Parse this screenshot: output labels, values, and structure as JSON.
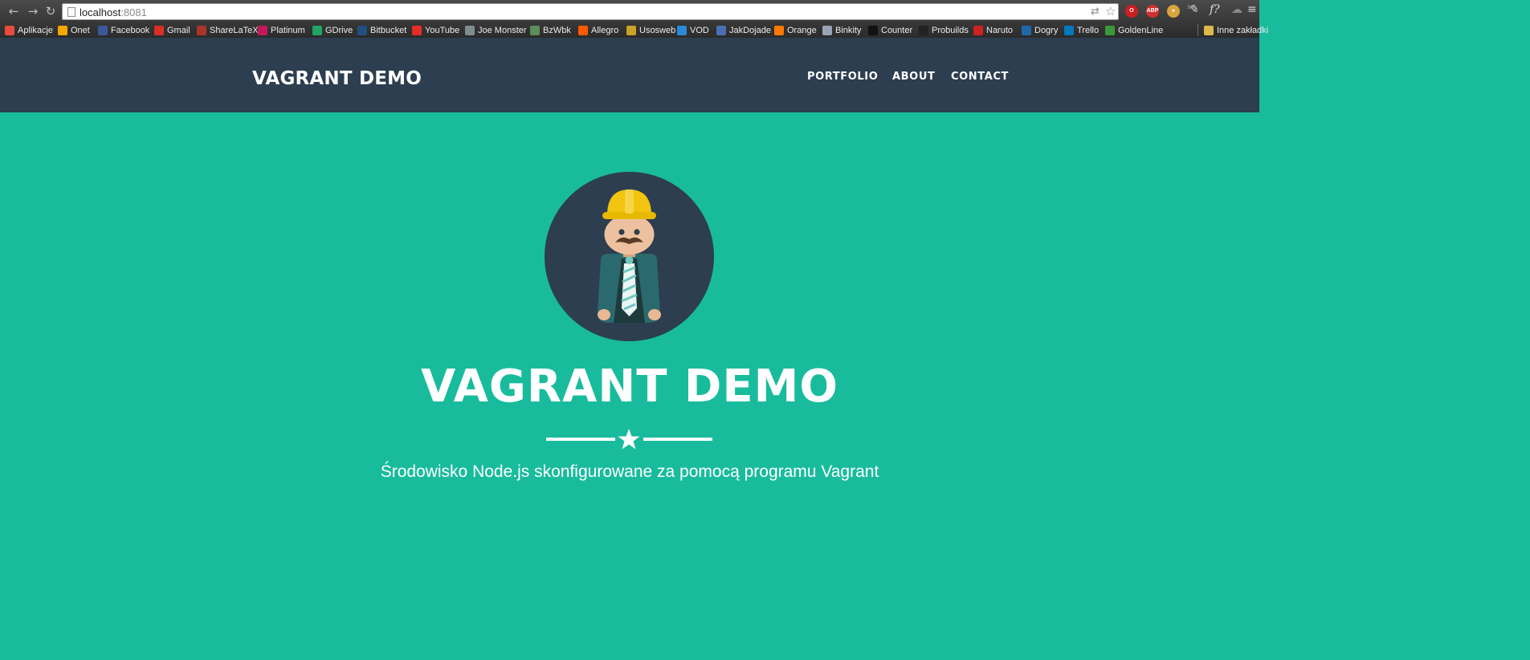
{
  "browser": {
    "url_host": "localhost",
    "url_port": ":8081",
    "bookmarks": [
      {
        "label": "Aplikacje",
        "icon": "apps-grid-icon",
        "color": "#e74c3c"
      },
      {
        "label": "Onet",
        "icon": "onet-icon",
        "color": "#f5a500"
      },
      {
        "label": "Facebook",
        "icon": "facebook-icon",
        "color": "#3b5998"
      },
      {
        "label": "Gmail",
        "icon": "gmail-icon",
        "color": "#d93025"
      },
      {
        "label": "ShareLaTeX",
        "icon": "sharelatex-icon",
        "color": "#a93529"
      },
      {
        "label": "Platinum",
        "icon": "platinum-icon",
        "color": "#c2185b"
      },
      {
        "label": "GDrive",
        "icon": "gdrive-icon",
        "color": "#1fa463"
      },
      {
        "label": "Bitbucket",
        "icon": "bitbucket-icon",
        "color": "#205081"
      },
      {
        "label": "YouTube",
        "icon": "youtube-icon",
        "color": "#e52d27"
      },
      {
        "label": "Joe Monster",
        "icon": "joemonster-icon",
        "color": "#7f8c8d"
      },
      {
        "label": "BzWbk",
        "icon": "bzwbk-icon",
        "color": "#5a8f5a"
      },
      {
        "label": "Allegro",
        "icon": "allegro-icon",
        "color": "#ff5a00"
      },
      {
        "label": "Usosweb",
        "icon": "usosweb-icon",
        "color": "#c9a227"
      },
      {
        "label": "VOD",
        "icon": "vod-icon",
        "color": "#2a8ad8"
      },
      {
        "label": "JakDojade",
        "icon": "jakdojade-icon",
        "color": "#4a6fb5"
      },
      {
        "label": "Orange",
        "icon": "orange-icon",
        "color": "#ff7900"
      },
      {
        "label": "Binkity",
        "icon": "binkity-icon",
        "color": "#9aa3b5"
      },
      {
        "label": "Counter",
        "icon": "counter-icon",
        "color": "#111111"
      },
      {
        "label": "Probuilds",
        "icon": "probuilds-icon",
        "color": "#222222"
      },
      {
        "label": "Naruto",
        "icon": "naruto-icon",
        "color": "#cc2222"
      },
      {
        "label": "Dogry",
        "icon": "dogry-icon",
        "color": "#1e6aa8"
      },
      {
        "label": "Trello",
        "icon": "trello-icon",
        "color": "#0079bf"
      },
      {
        "label": "GoldenLine",
        "icon": "goldenline-icon",
        "color": "#3a9a3a"
      }
    ],
    "other_bookmarks": "Inne zakładki"
  },
  "site": {
    "brand": "VAGRANT DEMO",
    "nav": [
      "PORTFOLIO",
      "ABOUT",
      "CONTACT"
    ],
    "hero_title": "VAGRANT DEMO",
    "hero_subtitle": "Środowisko Node.js skonfigurowane za pomocą programu Vagrant"
  },
  "colors": {
    "navbar": "#2c3e50",
    "hero": "#18bc9c",
    "avatar_bg": "#2c3e50",
    "helmet": "#f1c40f"
  }
}
